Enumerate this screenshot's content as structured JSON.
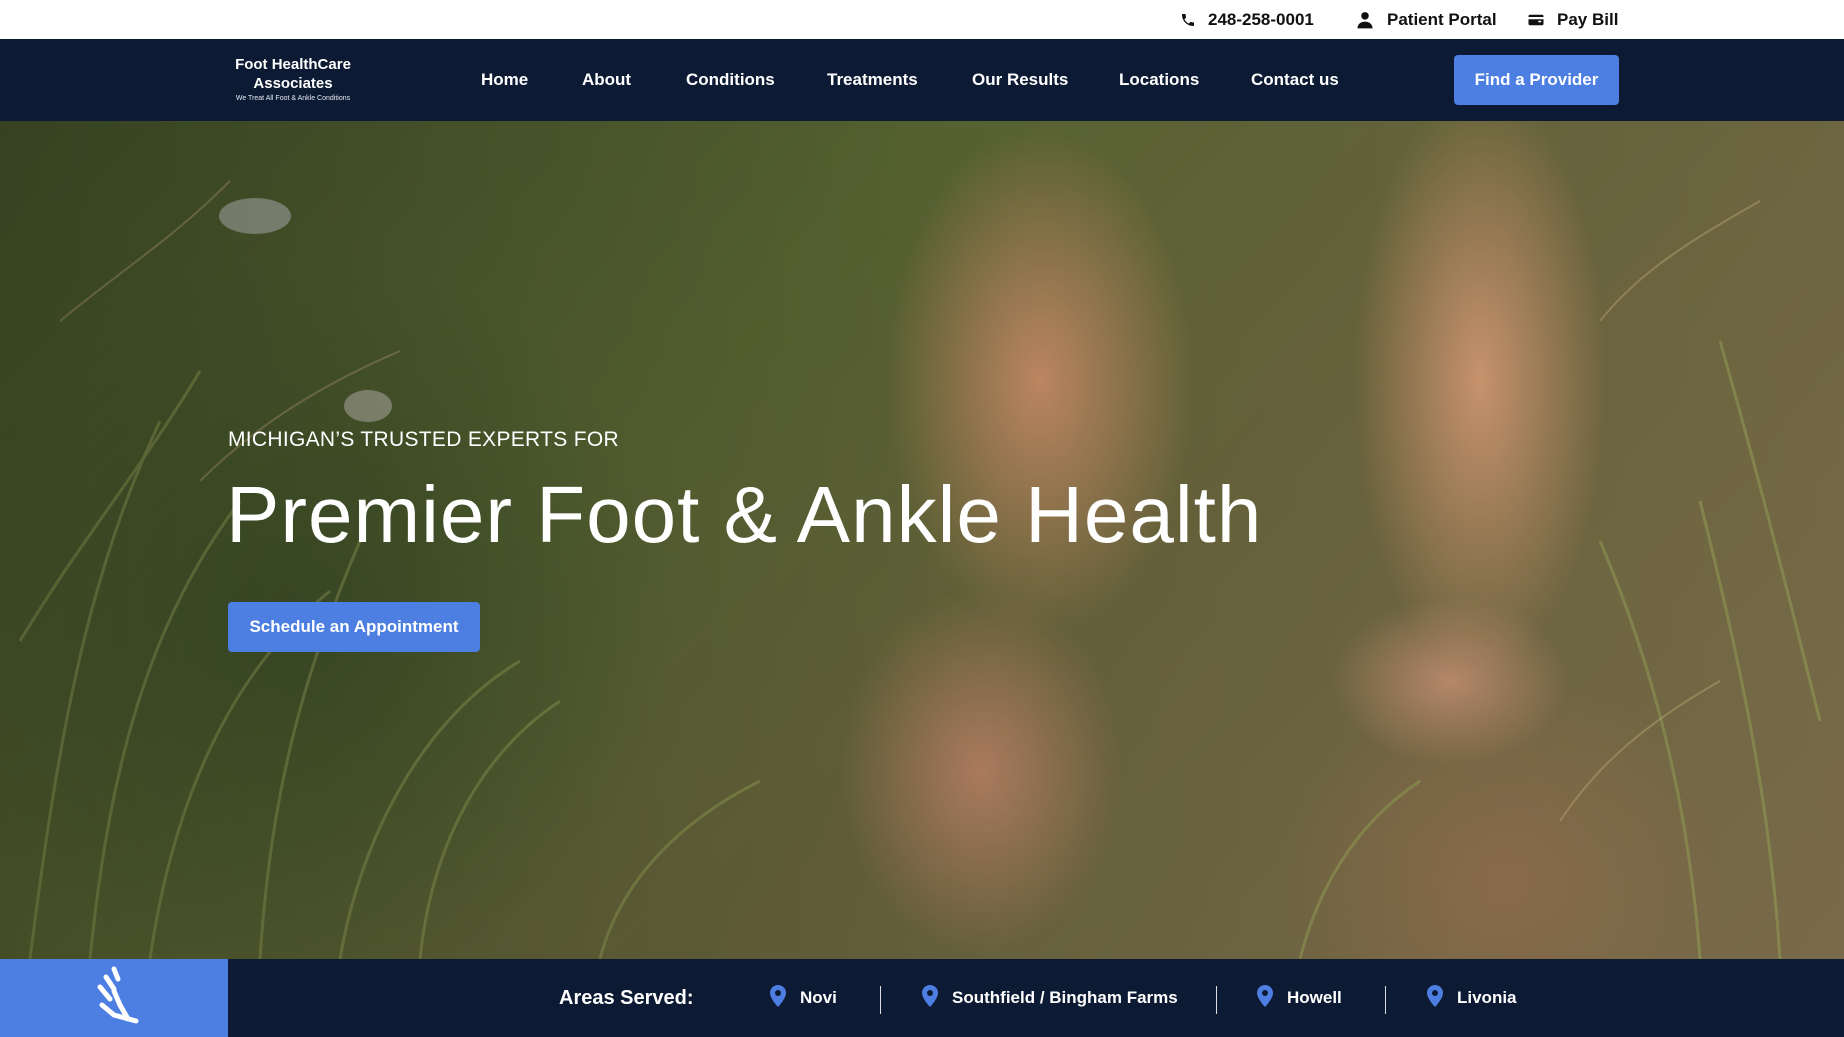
{
  "topbar": {
    "phone": "248-258-0001",
    "patient_portal": "Patient Portal",
    "pay_bill": "Pay Bill"
  },
  "logo": {
    "line1": "Foot HealthCare",
    "line2": "Associates",
    "tagline": "We Treat All Foot & Ankle Conditions"
  },
  "nav": {
    "items": [
      "Home",
      "About",
      "Conditions",
      "Treatments",
      "Our Results",
      "Locations",
      "Contact us"
    ],
    "cta": "Find a Provider"
  },
  "hero": {
    "eyebrow": "MICHIGAN’S TRUSTED EXPERTS FOR",
    "headline": "Premier Foot & Ankle Health",
    "cta": "Schedule an Appointment"
  },
  "areas": {
    "label": "Areas Served:",
    "locations": [
      "Novi",
      "Southfield / Bingham Farms",
      "Howell",
      "Livonia"
    ]
  },
  "colors": {
    "navy": "#0d1a33",
    "accent": "#4d7fe3",
    "white": "#ffffff"
  }
}
